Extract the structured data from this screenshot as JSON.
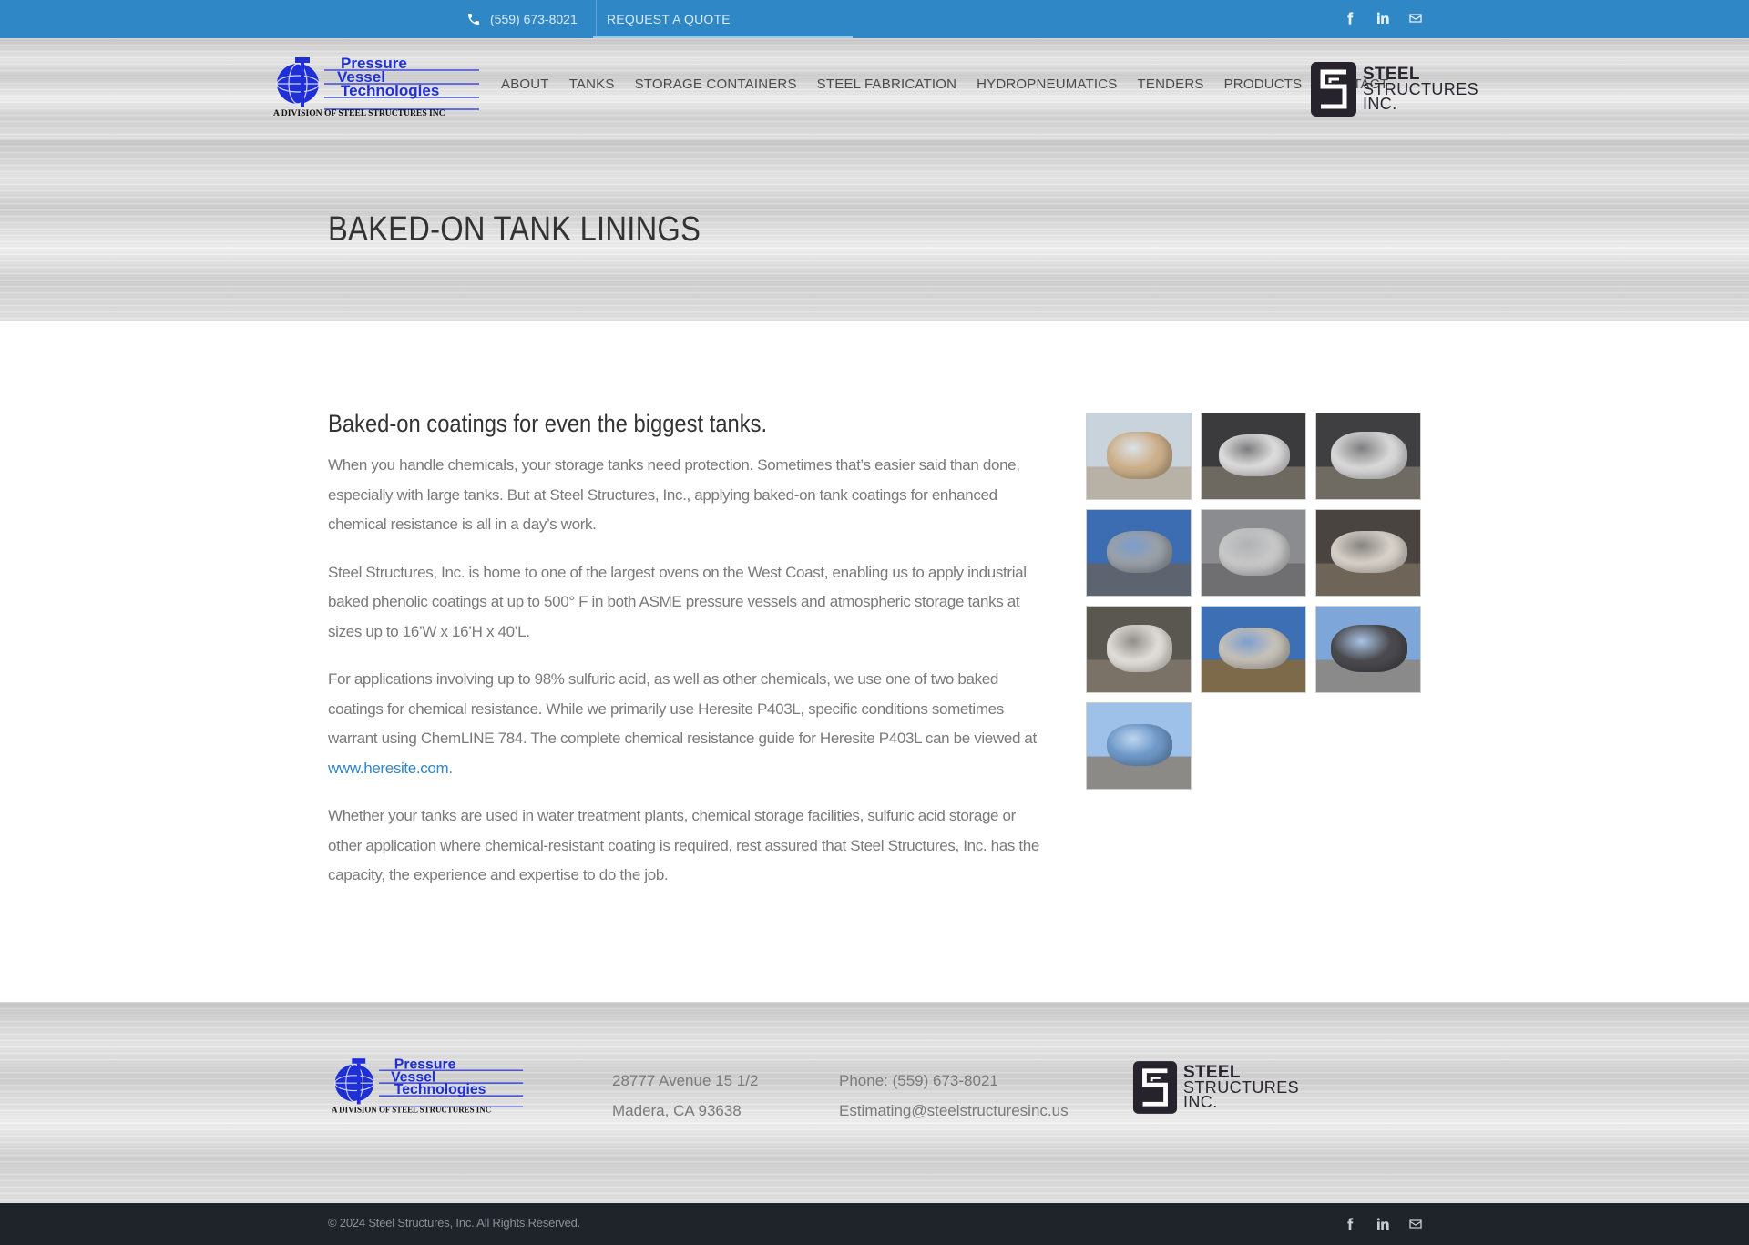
{
  "topbar": {
    "phone": "(559) 673-8021",
    "quote": "REQUEST A QUOTE",
    "social": [
      "facebook-icon",
      "linkedin-icon",
      "mail-icon"
    ]
  },
  "header": {
    "logo_left": {
      "line1": "Pressure",
      "line2": "Vessel",
      "line3": "Technologies",
      "tagline": "A DIVISION OF STEEL STRUCTURES INC"
    },
    "nav": [
      "ABOUT",
      "TANKS",
      "STORAGE CONTAINERS",
      "STEEL FABRICATION",
      "HYDROPNEUMATICS",
      "TENDERS",
      "PRODUCTS",
      "CONTACT"
    ],
    "logo_right": {
      "line1": "STEEL",
      "line2": "STRUCTURES",
      "line3": "INC."
    }
  },
  "page": {
    "title": "BAKED-ON TANK LININGS"
  },
  "content": {
    "heading": "Baked-on coatings for even the biggest tanks.",
    "p1": "When you handle chemicals, your storage tanks need protection. Sometimes that’s easier said than done, especially with large tanks. But at Steel Structures, Inc., applying baked-on tank coatings for enhanced chemical resistance is all in a day’s work.",
    "p2": "Steel Structures, Inc. is home to one of the largest ovens on the West Coast, enabling us to apply industrial baked phenolic coatings at up to 500° F in both ASME pressure vessels and atmospheric storage tanks at sizes up to 16’W x 16’H x 40’L.",
    "p3_text": "For applications involving up to 98% sulfuric acid, as well as other chemicals, we use one of two baked coatings for chemical resistance. While we primarily use Heresite P403L, specific conditions sometimes warrant using ChemLINE 784. The complete chemical resistance guide for Heresite P403L can be viewed at ",
    "p3_link": "www.heresite.com",
    "p3_end": ".",
    "p4": "Whether your tanks are used in water treatment plants, chemical storage facilities, sulfuric acid storage or other application where chemical-resistant coating is required, rest assured that Steel Structures, Inc. has the capacity, the experience and expertise to do the job."
  },
  "gallery": [
    {
      "bg": "#c9d3dc",
      "ground": "#b8b2a6",
      "tank": "#cdb08a"
    },
    {
      "bg": "#3b3b3e",
      "ground": "#6d6860",
      "tank": "#dcdcdc"
    },
    {
      "bg": "#3f3f42",
      "ground": "#6f6a62",
      "tank": "#d8d8d8"
    },
    {
      "bg": "#3c6db3",
      "ground": "#5d6470",
      "tank": "#9aa0a8"
    },
    {
      "bg": "#8a8c8f",
      "ground": "#6f6f72",
      "tank": "#c7c7c7"
    },
    {
      "bg": "#4a4440",
      "ground": "#6e6458",
      "tank": "#d7d1c8"
    },
    {
      "bg": "#5a5650",
      "ground": "#7a7266",
      "tank": "#e0ddd8"
    },
    {
      "bg": "#3d6fb5",
      "ground": "#7c6a4a",
      "tank": "#c6c1b8"
    },
    {
      "bg": "#7fa6d8",
      "ground": "#8a8a8a",
      "tank": "#4a4a4e"
    },
    {
      "bg": "#9dc1e8",
      "ground": "#8c8a86",
      "tank": "#6f99c9"
    }
  ],
  "footer": {
    "address1": "28777 Avenue 15 1/2",
    "address2": "Madera, CA 93638",
    "phone": "Phone: (559) 673-8021",
    "email": "Estimating@steelstructuresinc.us"
  },
  "copyright": "© 2024 Steel Structures, Inc. All Rights Reserved."
}
